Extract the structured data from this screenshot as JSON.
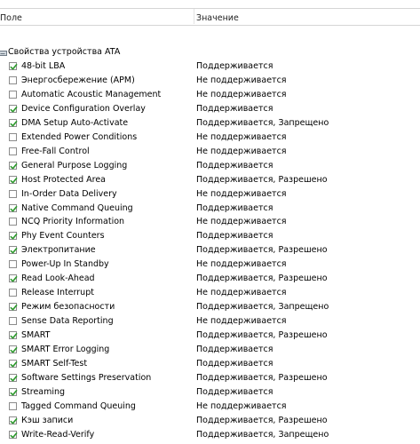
{
  "columns": {
    "field": "Поле",
    "value": "Значение"
  },
  "group": {
    "label": "Свойства устройства ATA",
    "icon": "drive-icon"
  },
  "rows": [
    {
      "name": "48-bit LBA",
      "checked": true,
      "value": "Поддерживается"
    },
    {
      "name": "Энергосбережение (APM)",
      "checked": false,
      "value": "Не поддерживается"
    },
    {
      "name": "Automatic Acoustic Management",
      "checked": false,
      "value": "Не поддерживается"
    },
    {
      "name": "Device Configuration Overlay",
      "checked": true,
      "value": "Поддерживается"
    },
    {
      "name": "DMA Setup Auto-Activate",
      "checked": true,
      "value": "Поддерживается, Запрещено"
    },
    {
      "name": "Extended Power Conditions",
      "checked": false,
      "value": "Не поддерживается"
    },
    {
      "name": "Free-Fall Control",
      "checked": false,
      "value": "Не поддерживается"
    },
    {
      "name": "General Purpose Logging",
      "checked": true,
      "value": "Поддерживается"
    },
    {
      "name": "Host Protected Area",
      "checked": true,
      "value": "Поддерживается, Разрешено"
    },
    {
      "name": "In-Order Data Delivery",
      "checked": false,
      "value": "Не поддерживается"
    },
    {
      "name": "Native Command Queuing",
      "checked": true,
      "value": "Поддерживается"
    },
    {
      "name": "NCQ Priority Information",
      "checked": false,
      "value": "Не поддерживается"
    },
    {
      "name": "Phy Event Counters",
      "checked": true,
      "value": "Поддерживается"
    },
    {
      "name": "Электропитание",
      "checked": true,
      "value": "Поддерживается, Разрешено"
    },
    {
      "name": "Power-Up In Standby",
      "checked": false,
      "value": "Не поддерживается"
    },
    {
      "name": "Read Look-Ahead",
      "checked": true,
      "value": "Поддерживается, Разрешено"
    },
    {
      "name": "Release Interrupt",
      "checked": false,
      "value": "Не поддерживается"
    },
    {
      "name": "Режим безопасности",
      "checked": true,
      "value": "Поддерживается, Запрещено"
    },
    {
      "name": "Sense Data Reporting",
      "checked": false,
      "value": "Не поддерживается"
    },
    {
      "name": "SMART",
      "checked": true,
      "value": "Поддерживается, Разрешено"
    },
    {
      "name": "SMART Error Logging",
      "checked": true,
      "value": "Поддерживается"
    },
    {
      "name": "SMART Self-Test",
      "checked": true,
      "value": "Поддерживается"
    },
    {
      "name": "Software Settings Preservation",
      "checked": true,
      "value": "Поддерживается, Разрешено"
    },
    {
      "name": "Streaming",
      "checked": true,
      "value": "Поддерживается"
    },
    {
      "name": "Tagged Command Queuing",
      "checked": false,
      "value": "Не поддерживается"
    },
    {
      "name": "Кэш записи",
      "checked": true,
      "value": "Поддерживается, Разрешено"
    },
    {
      "name": "Write-Read-Verify",
      "checked": true,
      "value": "Поддерживается, Запрещено"
    }
  ],
  "colors": {
    "check": "#2f9a2f",
    "checkbox_border": "#8c8c8c"
  }
}
